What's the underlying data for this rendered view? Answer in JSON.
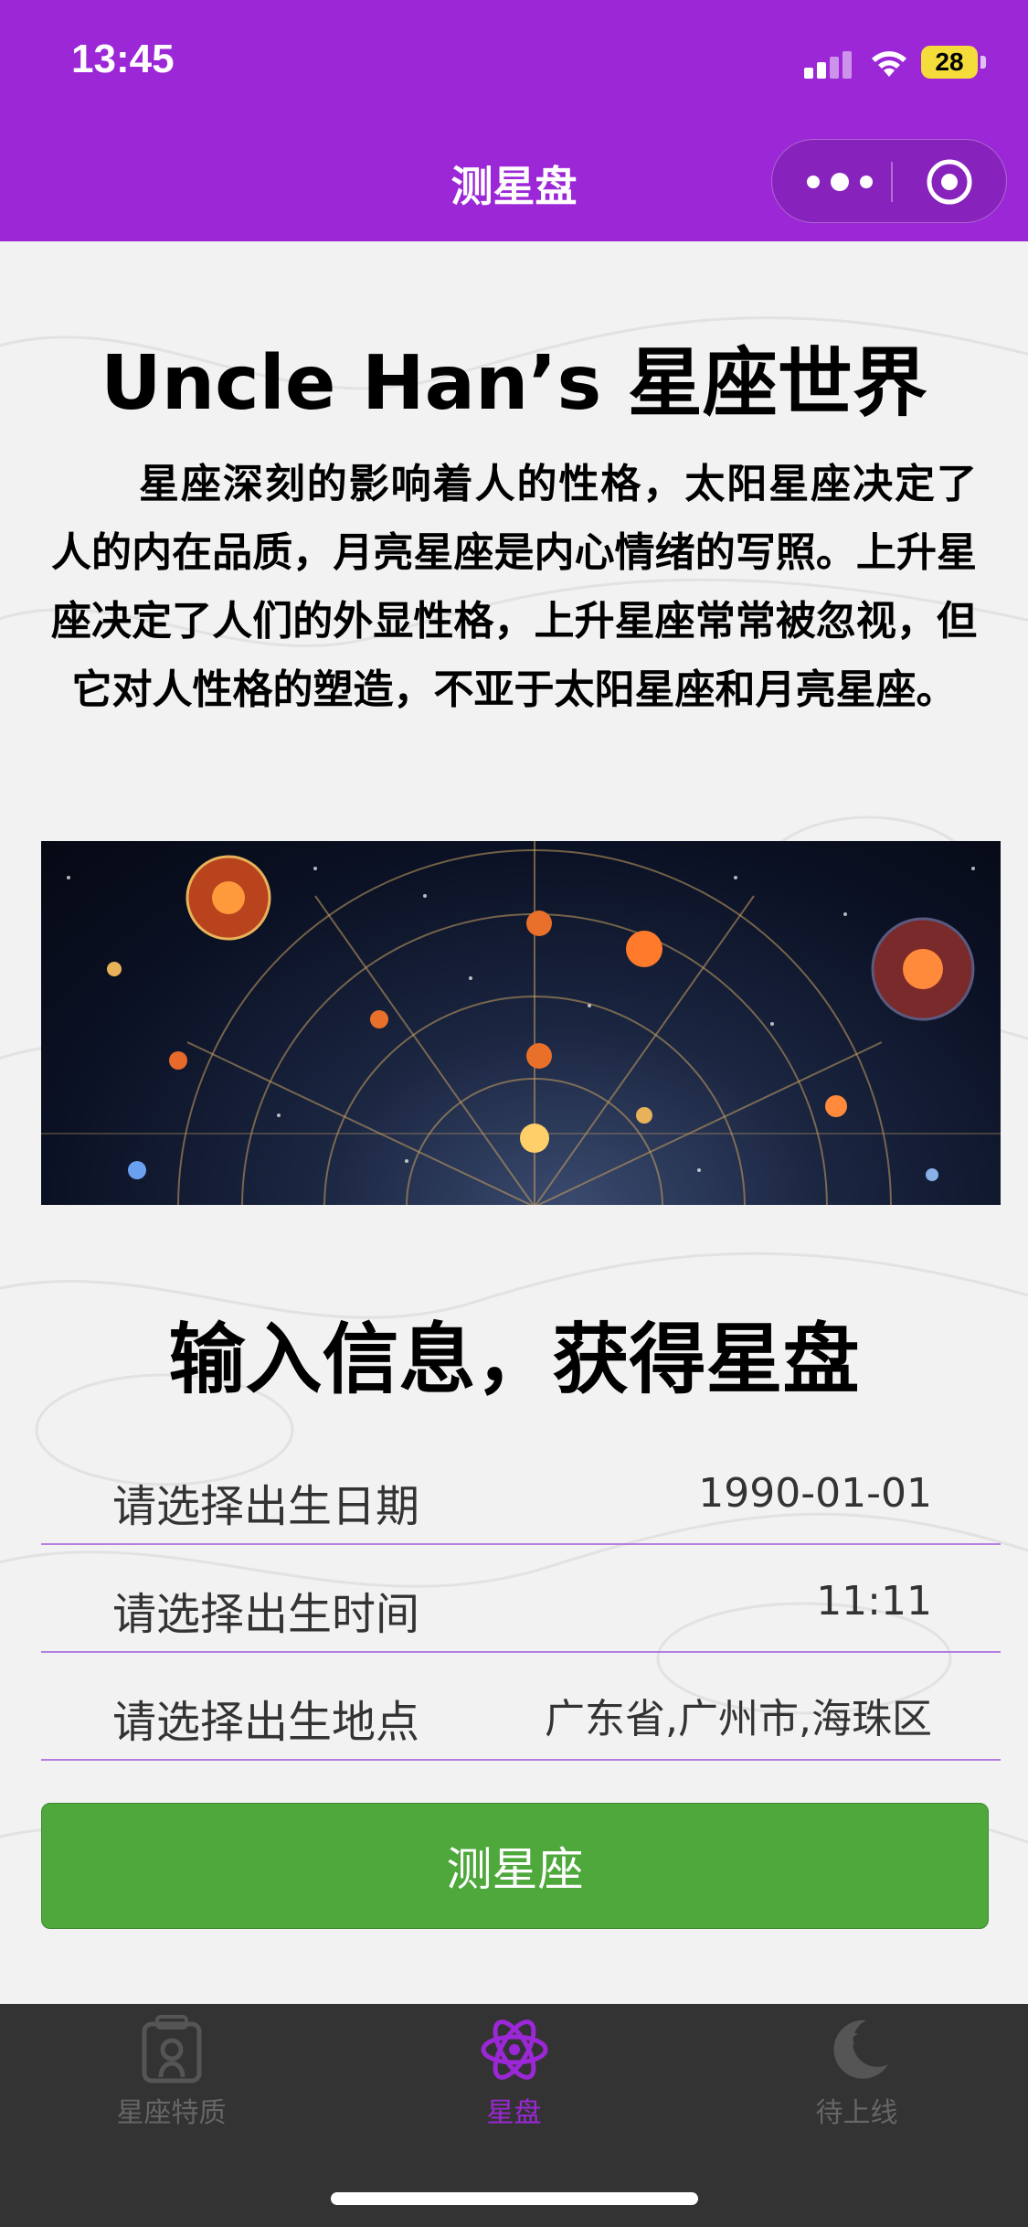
{
  "status_bar": {
    "time": "13:45",
    "battery": "28"
  },
  "nav": {
    "title": "测星盘"
  },
  "hero": {
    "title": "Uncle Han’s 星座世界",
    "intro": "星座深刻的影响着人的性格，太阳星座决定了人的内在品质，月亮星座是内心情绪的写照。上升星座决定了人们的外显性格，上升星座常常被忽视，但它对人性格的塑造，不亚于太阳星座和月亮星座。"
  },
  "form": {
    "title": "输入信息，获得星盘",
    "rows": [
      {
        "label": "请选择出生日期",
        "value": "1990-01-01"
      },
      {
        "label": "请选择出生时间",
        "value": "11:11"
      },
      {
        "label": "请选择出生地点",
        "value": "广东省,广州市,海珠区"
      }
    ],
    "submit_label": "测星座"
  },
  "tabbar": {
    "items": [
      {
        "label": "星座特质",
        "icon": "portrait-icon",
        "active": false
      },
      {
        "label": "星盘",
        "icon": "atom-star-icon",
        "active": true
      },
      {
        "label": "待上线",
        "icon": "moon-star-icon",
        "active": false
      }
    ]
  },
  "colors": {
    "brand": "#9b27d6",
    "button": "#4ea83b",
    "tabbar": "#333333"
  }
}
